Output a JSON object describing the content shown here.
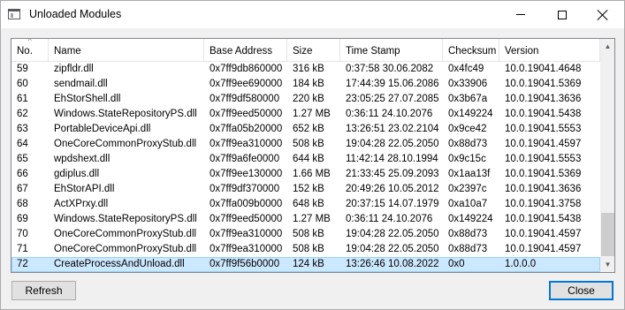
{
  "window": {
    "title": "Unloaded Modules"
  },
  "columns": {
    "no": "No.",
    "name": "Name",
    "base": "Base Address",
    "size": "Size",
    "time": "Time Stamp",
    "checksum": "Checksum",
    "version": "Version"
  },
  "rows": [
    {
      "no": "59",
      "name": "zipfldr.dll",
      "base": "0x7ff9db860000",
      "size": "316 kB",
      "time": "0:37:58 30.06.2082",
      "checksum": "0x4fc49",
      "version": "10.0.19041.4648"
    },
    {
      "no": "60",
      "name": "sendmail.dll",
      "base": "0x7ff9ee690000",
      "size": "184 kB",
      "time": "17:44:39 15.06.2086",
      "checksum": "0x33906",
      "version": "10.0.19041.5369"
    },
    {
      "no": "61",
      "name": "EhStorShell.dll",
      "base": "0x7ff9df580000",
      "size": "220 kB",
      "time": "23:05:25 27.07.2085",
      "checksum": "0x3b67a",
      "version": "10.0.19041.3636"
    },
    {
      "no": "62",
      "name": "Windows.StateRepositoryPS.dll",
      "base": "0x7ff9eed50000",
      "size": "1.27 MB",
      "time": "0:36:11 24.10.2076",
      "checksum": "0x149224",
      "version": "10.0.19041.5438"
    },
    {
      "no": "63",
      "name": "PortableDeviceApi.dll",
      "base": "0x7ffa05b20000",
      "size": "652 kB",
      "time": "13:26:51 23.02.2104",
      "checksum": "0x9ce42",
      "version": "10.0.19041.5553"
    },
    {
      "no": "64",
      "name": "OneCoreCommonProxyStub.dll",
      "base": "0x7ff9ea310000",
      "size": "508 kB",
      "time": "19:04:28 22.05.2050",
      "checksum": "0x88d73",
      "version": "10.0.19041.4597"
    },
    {
      "no": "65",
      "name": "wpdshext.dll",
      "base": "0x7ff9a6fe0000",
      "size": "644 kB",
      "time": "11:42:14 28.10.1994",
      "checksum": "0x9c15c",
      "version": "10.0.19041.5553"
    },
    {
      "no": "66",
      "name": "gdiplus.dll",
      "base": "0x7ff9ee130000",
      "size": "1.66 MB",
      "time": "21:33:45 25.09.2093",
      "checksum": "0x1aa13f",
      "version": "10.0.19041.5369"
    },
    {
      "no": "67",
      "name": "EhStorAPI.dll",
      "base": "0x7ff9df370000",
      "size": "152 kB",
      "time": "20:49:26 10.05.2012",
      "checksum": "0x2397c",
      "version": "10.0.19041.3636"
    },
    {
      "no": "68",
      "name": "ActXPrxy.dll",
      "base": "0x7ffa009b0000",
      "size": "648 kB",
      "time": "20:37:15 14.07.1979",
      "checksum": "0xa10a7",
      "version": "10.0.19041.3758"
    },
    {
      "no": "69",
      "name": "Windows.StateRepositoryPS.dll",
      "base": "0x7ff9eed50000",
      "size": "1.27 MB",
      "time": "0:36:11 24.10.2076",
      "checksum": "0x149224",
      "version": "10.0.19041.5438"
    },
    {
      "no": "70",
      "name": "OneCoreCommonProxyStub.dll",
      "base": "0x7ff9ea310000",
      "size": "508 kB",
      "time": "19:04:28 22.05.2050",
      "checksum": "0x88d73",
      "version": "10.0.19041.4597"
    },
    {
      "no": "71",
      "name": "OneCoreCommonProxyStub.dll",
      "base": "0x7ff9ea310000",
      "size": "508 kB",
      "time": "19:04:28 22.05.2050",
      "checksum": "0x88d73",
      "version": "10.0.19041.4597"
    },
    {
      "no": "72",
      "name": "CreateProcessAndUnload.dll",
      "base": "0x7ff9f56b0000",
      "size": "124 kB",
      "time": "13:26:46 10.08.2022",
      "checksum": "0x0",
      "version": "1.0.0.0",
      "selected": true
    }
  ],
  "buttons": {
    "refresh": "Refresh",
    "close": "Close"
  },
  "icons": {
    "app": "window-app-icon",
    "minimize": "minimize-icon",
    "maximize": "maximize-icon",
    "close": "close-icon",
    "sort": "sort-ascending-icon",
    "scroll_up": "chevron-up-icon",
    "scroll_down": "chevron-down-icon"
  },
  "colors": {
    "selection": "#cce8ff",
    "selection_border": "#99d1ff",
    "default_button_border": "#0078d7"
  }
}
